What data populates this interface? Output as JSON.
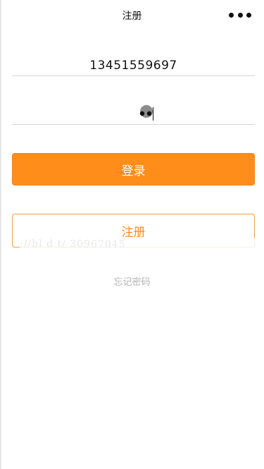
{
  "nav": {
    "title": "注册",
    "more_icon": "more-dots-icon"
  },
  "form": {
    "phone_value": "13451559697",
    "password_icon": "password-mask-icon"
  },
  "buttons": {
    "login_label": "登录",
    "register_label": "注册",
    "forgot_label": "忘记密码"
  },
  "watermark": {
    "text": "    ://bl          d   t/     30967045"
  },
  "colors": {
    "accent": "#ff8d1a",
    "divider": "#d6d6d6",
    "muted": "#b3b3b3"
  }
}
